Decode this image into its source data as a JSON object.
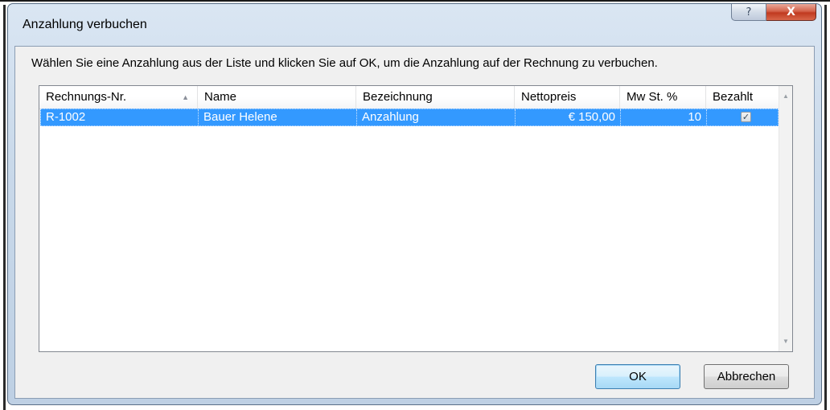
{
  "dialog": {
    "title": "Anzahlung verbuchen",
    "help_glyph": "?",
    "close_glyph": "X"
  },
  "instruction": "Wählen Sie eine Anzahlung aus der Liste und klicken Sie auf OK, um die Anzahlung auf der Rechnung zu verbuchen.",
  "table": {
    "columns": [
      "Rechnungs-Nr.",
      "Name",
      "Bezeichnung",
      "Nettopreis",
      "Mw St. %",
      "Bezahlt"
    ],
    "sorted_column": "Rechnungs-Nr.",
    "sort_glyph": "▲",
    "rows": [
      {
        "rechnungs_nr": "R-1002",
        "name": "Bauer Helene",
        "bezeichnung": "Anzahlung",
        "nettopreis": "€ 150,00",
        "mwst": "10",
        "bezahlt": true,
        "bezahlt_glyph": "✓",
        "selected": true
      }
    ],
    "scroll_up_glyph": "▲",
    "scroll_down_glyph": "▼"
  },
  "buttons": {
    "ok": "OK",
    "cancel": "Abbrechen"
  },
  "colors": {
    "selection": "#3399ff",
    "close_button": "#c0391f",
    "default_button_border": "#3c7fb1"
  }
}
